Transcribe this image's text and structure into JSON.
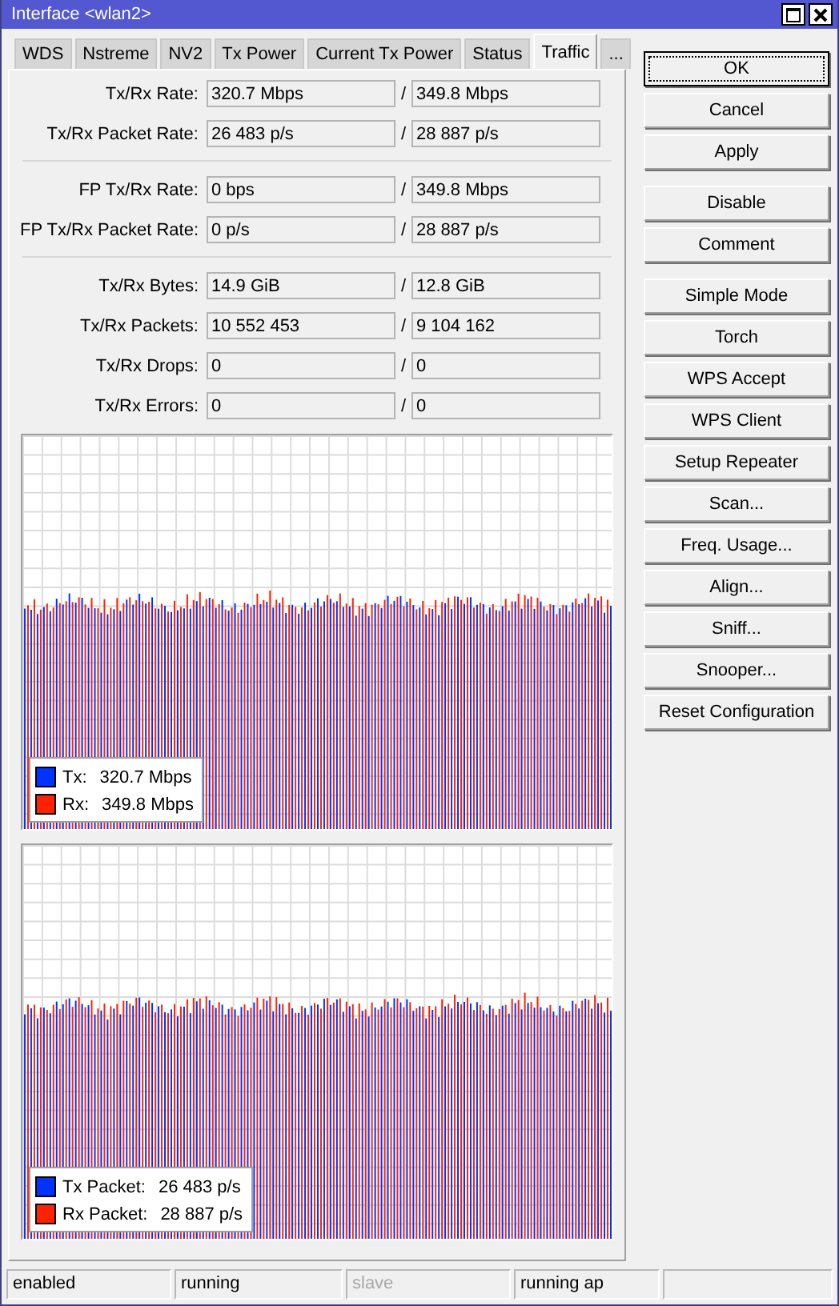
{
  "window": {
    "title": "Interface <wlan2>"
  },
  "tabs": [
    {
      "label": "WDS",
      "selected": false
    },
    {
      "label": "Nstreme",
      "selected": false
    },
    {
      "label": "NV2",
      "selected": false
    },
    {
      "label": "Tx Power",
      "selected": false
    },
    {
      "label": "Current Tx Power",
      "selected": false
    },
    {
      "label": "Status",
      "selected": false
    },
    {
      "label": "Traffic",
      "selected": true
    },
    {
      "label": "...",
      "selected": false
    }
  ],
  "stat_groups": [
    [
      {
        "label": "Tx/Rx Rate:",
        "tx": "320.7 Mbps",
        "separator": "/",
        "rx": "349.8 Mbps"
      },
      {
        "label": "Tx/Rx Packet Rate:",
        "tx": "26 483 p/s",
        "separator": "/",
        "rx": "28 887 p/s"
      }
    ],
    [
      {
        "label": "FP Tx/Rx Rate:",
        "tx": "0 bps",
        "separator": "/",
        "rx": "349.8 Mbps"
      },
      {
        "label": "FP Tx/Rx Packet Rate:",
        "tx": "0 p/s",
        "separator": "/",
        "rx": "28 887 p/s"
      }
    ],
    [
      {
        "label": "Tx/Rx Bytes:",
        "tx": "14.9 GiB",
        "separator": "/",
        "rx": "12.8 GiB"
      },
      {
        "label": "Tx/Rx Packets:",
        "tx": "10 552 453",
        "separator": "/",
        "rx": "9 104 162"
      },
      {
        "label": "Tx/Rx Drops:",
        "tx": "0",
        "separator": "/",
        "rx": "0"
      },
      {
        "label": "Tx/Rx Errors:",
        "tx": "0",
        "separator": "/",
        "rx": "0"
      }
    ]
  ],
  "graphs": [
    {
      "legend": [
        {
          "label": "Tx:",
          "value": "320.7 Mbps",
          "color": "#0033ff"
        },
        {
          "label": "Rx:",
          "value": "349.8 Mbps",
          "color": "#ff2200"
        }
      ]
    },
    {
      "legend": [
        {
          "label": "Tx Packet:",
          "value": "26 483 p/s",
          "color": "#0033ff"
        },
        {
          "label": "Rx Packet:",
          "value": "28 887 p/s",
          "color": "#ff2200"
        }
      ]
    }
  ],
  "button_groups": [
    [
      {
        "label": "OK",
        "focused": true
      },
      {
        "label": "Cancel",
        "focused": false
      },
      {
        "label": "Apply",
        "focused": false
      }
    ],
    [
      {
        "label": "Disable",
        "focused": false
      },
      {
        "label": "Comment",
        "focused": false
      }
    ],
    [
      {
        "label": "Simple Mode",
        "focused": false
      },
      {
        "label": "Torch",
        "focused": false
      },
      {
        "label": "WPS Accept",
        "focused": false
      },
      {
        "label": "WPS Client",
        "focused": false
      },
      {
        "label": "Setup Repeater",
        "focused": false
      },
      {
        "label": "Scan...",
        "focused": false
      },
      {
        "label": "Freq. Usage...",
        "focused": false
      },
      {
        "label": "Align...",
        "focused": false
      },
      {
        "label": "Sniff...",
        "focused": false
      },
      {
        "label": "Snooper...",
        "focused": false
      },
      {
        "label": "Reset Configuration",
        "focused": false
      }
    ]
  ],
  "status_bar": [
    {
      "text": "enabled",
      "disabled": false
    },
    {
      "text": "running",
      "disabled": false
    },
    {
      "text": "slave",
      "disabled": true
    },
    {
      "text": "running ap",
      "disabled": false
    }
  ]
}
